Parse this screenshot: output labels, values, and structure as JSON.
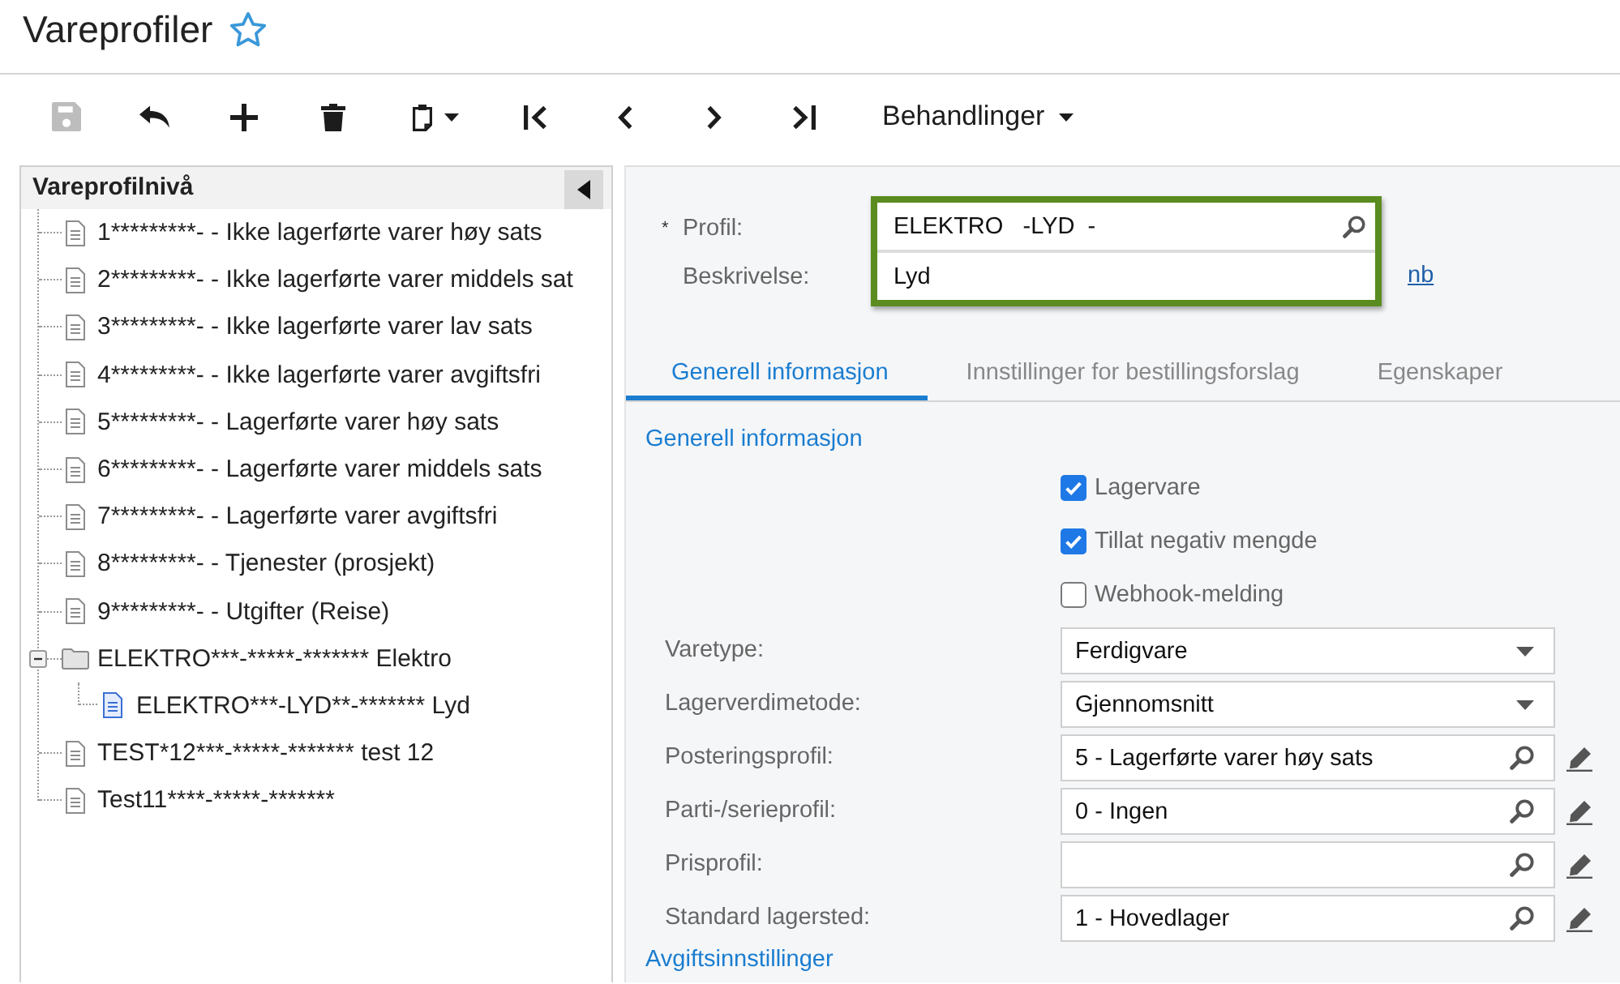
{
  "page": {
    "title": "Vareprofiler",
    "favorite": false
  },
  "toolbar": {
    "buttons": [
      {
        "kind": "save",
        "disabled": true
      },
      {
        "kind": "undo",
        "disabled": false
      },
      {
        "kind": "add",
        "disabled": false
      },
      {
        "kind": "delete",
        "disabled": false
      },
      {
        "kind": "paste",
        "disabled": false
      },
      {
        "kind": "first",
        "disabled": false
      },
      {
        "kind": "previous",
        "disabled": false
      },
      {
        "kind": "next",
        "disabled": false
      },
      {
        "kind": "last",
        "disabled": false
      }
    ],
    "actions_menu": {
      "label": "Behandlinger"
    }
  },
  "tree": {
    "title": "Vareprofilnivå",
    "items": [
      {
        "label": "1*********- - Ikke lagerførte varer høy sats",
        "kind": "document",
        "selected": false
      },
      {
        "label": "2*********- - Ikke lagerførte varer middels sat",
        "kind": "document",
        "selected": false
      },
      {
        "label": "3*********- - Ikke lagerførte varer lav sats",
        "kind": "document",
        "selected": false
      },
      {
        "label": "4*********- - Ikke lagerførte varer avgiftsfri",
        "kind": "document",
        "selected": false
      },
      {
        "label": "5*********- - Lagerførte varer høy sats",
        "kind": "document",
        "selected": false
      },
      {
        "label": "6*********- - Lagerførte varer middels sats",
        "kind": "document",
        "selected": false
      },
      {
        "label": "7*********- - Lagerførte varer avgiftsfri",
        "kind": "document",
        "selected": false
      },
      {
        "label": "8*********- - Tjenester (prosjekt)",
        "kind": "document",
        "selected": false
      },
      {
        "label": "9*********- - Utgifter (Reise)",
        "kind": "document",
        "selected": false
      },
      {
        "label": "ELEKTRO***-*****-******* Elektro",
        "kind": "folder",
        "selected": false,
        "expanded": true,
        "children": [
          {
            "label": "ELEKTRO***-LYD**-******* Lyd",
            "kind": "document",
            "selected": true
          }
        ]
      },
      {
        "label": "TEST*12***-*****-******* test 12",
        "kind": "document",
        "selected": false
      },
      {
        "label": "Test11****-*****-*******",
        "kind": "document",
        "selected": false
      }
    ]
  },
  "header": {
    "highlighted": true,
    "fields": [
      {
        "mark": "*",
        "label": "Profil:",
        "value": "ELEKTRO   -LYD  -",
        "kind": "lookup"
      },
      {
        "label": "Beskrivelse:",
        "value": "Lyd",
        "kind": "text"
      }
    ],
    "language_link": "nb"
  },
  "tabs": [
    {
      "label": "Generell informasjon",
      "selected": true
    },
    {
      "label": "Innstillinger for bestillingsforslag",
      "selected": false
    },
    {
      "label": "Egenskaper",
      "selected": false
    }
  ],
  "general": {
    "section_title": "Generell informasjon",
    "checkboxes": [
      {
        "label": "Lagervare",
        "checked": true
      },
      {
        "label": "Tillat negativ mengde",
        "checked": true
      },
      {
        "label": "Webhook-melding",
        "checked": false
      }
    ],
    "fields": [
      {
        "label": "Varetype:",
        "value": "Ferdigvare",
        "kind": "dropdown"
      },
      {
        "label": "Lagerverdimetode:",
        "value": "Gjennomsnitt",
        "kind": "dropdown"
      },
      {
        "label": "Posteringsprofil:",
        "value": "5 - Lagerførte varer høy sats",
        "kind": "lookup"
      },
      {
        "label": "Parti-/serieprofil:",
        "value": "0 - Ingen",
        "kind": "lookup"
      },
      {
        "label": "Prisprofil:",
        "kind": "lookup"
      },
      {
        "label": "Standard lagersted:",
        "value": "1 - Hovedlager",
        "kind": "lookup"
      }
    ],
    "next_section_title": "Avgiftsinnstillinger"
  }
}
